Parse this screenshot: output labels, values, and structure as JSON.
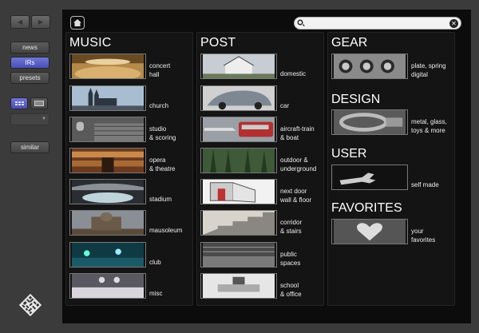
{
  "sidebar": {
    "buttons": [
      {
        "label": "news"
      },
      {
        "label": "IRs"
      },
      {
        "label": "presets"
      },
      {
        "label": "similar"
      }
    ],
    "icons": [
      "arrow-left-icon",
      "arrow-right-icon",
      "grid-view-icon",
      "list-view-icon"
    ]
  },
  "search": {
    "value": "",
    "placeholder": ""
  },
  "music": {
    "title": "MUSIC",
    "items": [
      {
        "line1": "concert",
        "line2": "hall"
      },
      {
        "line1": "church",
        "line2": ""
      },
      {
        "line1": "studio",
        "line2": "& scoring"
      },
      {
        "line1": "opera",
        "line2": "& theatre"
      },
      {
        "line1": "stadium",
        "line2": ""
      },
      {
        "line1": "mausoleum",
        "line2": ""
      },
      {
        "line1": "club",
        "line2": ""
      },
      {
        "line1": "misc",
        "line2": ""
      }
    ]
  },
  "post": {
    "title": "POST",
    "items": [
      {
        "line1": "domestic",
        "line2": ""
      },
      {
        "line1": "car",
        "line2": ""
      },
      {
        "line1": "aircraft-train",
        "line2": "& boat"
      },
      {
        "line1": "outdoor &",
        "line2": "underground"
      },
      {
        "line1": "next door",
        "line2": "wall & floor"
      },
      {
        "line1": "corridor",
        "line2": "& stairs"
      },
      {
        "line1": "public",
        "line2": "spaces"
      },
      {
        "line1": "school",
        "line2": "& office"
      }
    ]
  },
  "gear": {
    "title": "GEAR",
    "line1": "plate, spring",
    "line2": "digital"
  },
  "design": {
    "title": "DESIGN",
    "line1": "metal, glass,",
    "line2": "toys & more"
  },
  "user": {
    "title": "USER",
    "line1": "self made"
  },
  "favorites": {
    "title": "FAVORITES",
    "line1": "your",
    "line2": "favorites"
  }
}
